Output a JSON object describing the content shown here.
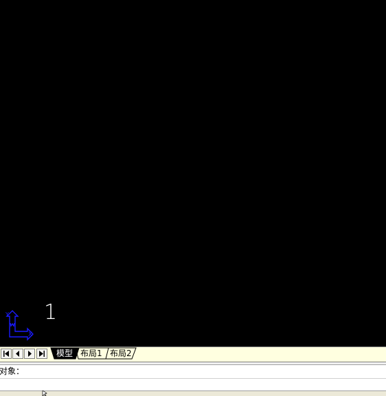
{
  "canvas": {
    "background": "#000000",
    "mark_text": "1",
    "ucs_icon": "ucs-axes-icon",
    "ucs_color": "#1a1aff"
  },
  "tab_bar": {
    "background": "#ffffe0",
    "nav_buttons": [
      {
        "name": "first-tab-icon"
      },
      {
        "name": "previous-tab-icon"
      },
      {
        "name": "next-tab-icon"
      },
      {
        "name": "last-tab-icon"
      }
    ],
    "tabs": [
      {
        "label": "模型",
        "active": true
      },
      {
        "label": "布局1",
        "active": false
      },
      {
        "label": "布局2",
        "active": false
      }
    ]
  },
  "command": {
    "prompt": "对象：",
    "input_value": ""
  }
}
